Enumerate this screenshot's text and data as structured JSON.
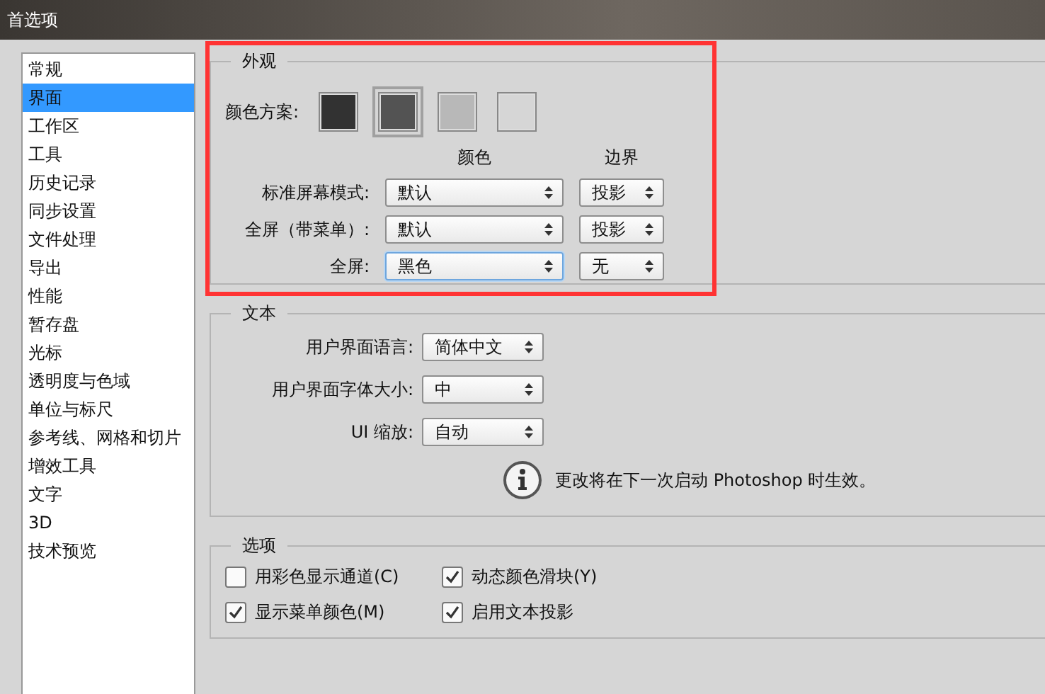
{
  "window": {
    "title": "首选项"
  },
  "sidebar": {
    "items": [
      {
        "label": "常规",
        "selected": false
      },
      {
        "label": "界面",
        "selected": true
      },
      {
        "label": "工作区",
        "selected": false
      },
      {
        "label": "工具",
        "selected": false
      },
      {
        "label": "历史记录",
        "selected": false
      },
      {
        "label": "同步设置",
        "selected": false
      },
      {
        "label": "文件处理",
        "selected": false
      },
      {
        "label": "导出",
        "selected": false
      },
      {
        "label": "性能",
        "selected": false
      },
      {
        "label": "暂存盘",
        "selected": false
      },
      {
        "label": "光标",
        "selected": false
      },
      {
        "label": "透明度与色域",
        "selected": false
      },
      {
        "label": "单位与标尺",
        "selected": false
      },
      {
        "label": "参考线、网格和切片",
        "selected": false
      },
      {
        "label": "增效工具",
        "selected": false
      },
      {
        "label": "文字",
        "selected": false
      },
      {
        "label": "3D",
        "selected": false
      },
      {
        "label": "技术预览",
        "selected": false
      }
    ]
  },
  "appearance": {
    "legend": "外观",
    "color_scheme_label": "颜色方案:",
    "color_schemes": [
      {
        "color": "#323232",
        "selected": false
      },
      {
        "color": "#535353",
        "selected": true
      },
      {
        "color": "#b8b8b8",
        "selected": false
      },
      {
        "color": "#d6d6d6",
        "selected": false
      }
    ],
    "column_headers": [
      "颜色",
      "边界"
    ],
    "rows": [
      {
        "label": "标准屏幕模式:",
        "color_value": "默认",
        "border": "投影",
        "focused": false
      },
      {
        "label": "全屏（带菜单）:",
        "color_value": "默认",
        "border": "投影",
        "focused": false
      },
      {
        "label": "全屏:",
        "color_value": "黑色",
        "border": "无",
        "focused": true
      }
    ]
  },
  "text": {
    "legend": "文本",
    "rows": [
      {
        "label": "用户界面语言:",
        "value": "简体中文"
      },
      {
        "label": "用户界面字体大小:",
        "value": "中"
      },
      {
        "label": "UI 缩放:",
        "value": "自动"
      }
    ],
    "notice": "更改将在下一次启动 Photoshop 时生效。"
  },
  "options": {
    "legend": "选项",
    "checkboxes": [
      {
        "label": "用彩色显示通道(C)",
        "checked": false
      },
      {
        "label": "动态颜色滑块(Y)",
        "checked": true
      },
      {
        "label": "显示菜单颜色(M)",
        "checked": true
      },
      {
        "label": "启用文本投影",
        "checked": true
      }
    ]
  }
}
